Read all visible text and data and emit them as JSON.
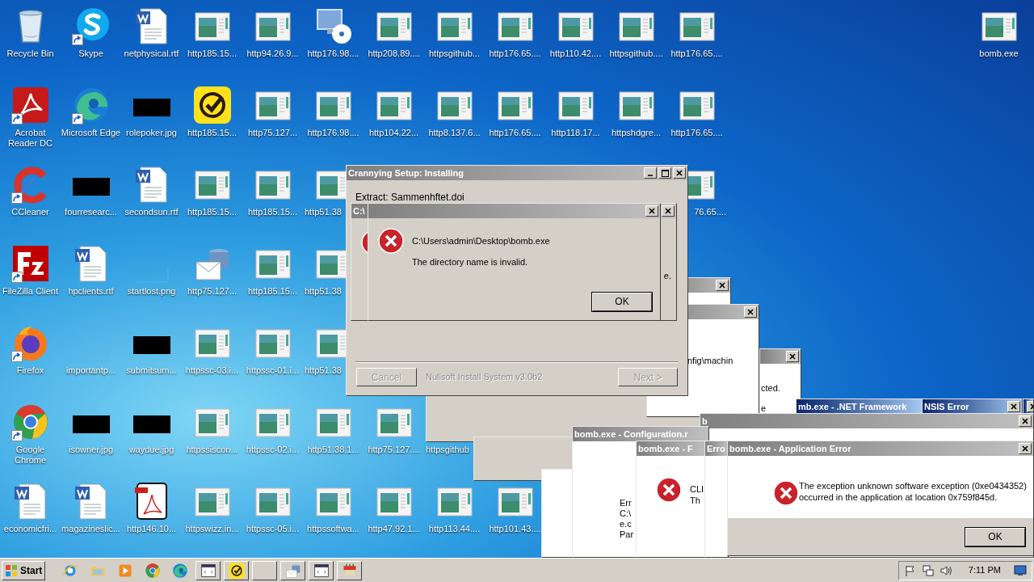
{
  "desktop": {
    "rows": [
      [
        {
          "label": "Recycle Bin",
          "kind": "recycle",
          "shortcut": false
        },
        {
          "label": "Skype",
          "kind": "skype",
          "shortcut": true
        },
        {
          "label": "netphysical.rtf",
          "kind": "word",
          "shortcut": false
        },
        {
          "label": "http185.15...",
          "kind": "web",
          "shortcut": false
        },
        {
          "label": "http94.26.9...",
          "kind": "web",
          "shortcut": false
        },
        {
          "label": "http176.98....",
          "kind": "setup",
          "shortcut": false
        },
        {
          "label": "http208.89....",
          "kind": "web",
          "shortcut": false
        },
        {
          "label": "httpsgithub...",
          "kind": "web",
          "shortcut": false
        },
        {
          "label": "http176.65....",
          "kind": "web",
          "shortcut": false
        },
        {
          "label": "http110.42....",
          "kind": "web",
          "shortcut": false
        },
        {
          "label": "httpsgithub....",
          "kind": "web",
          "shortcut": false
        },
        {
          "label": "http176.65....",
          "kind": "web",
          "shortcut": false
        }
      ],
      [
        {
          "label": "Acrobat\nReader DC",
          "kind": "acrobat",
          "shortcut": true
        },
        {
          "label": "Microsoft Edge",
          "kind": "edge",
          "shortcut": true
        },
        {
          "label": "rolepoker.jpg",
          "kind": "redacted",
          "shortcut": false
        },
        {
          "label": "http185.15...",
          "kind": "norton",
          "shortcut": false
        },
        {
          "label": "http75.127...",
          "kind": "web",
          "shortcut": false
        },
        {
          "label": "http176.98....",
          "kind": "web",
          "shortcut": false
        },
        {
          "label": "http104.22...",
          "kind": "web",
          "shortcut": false
        },
        {
          "label": "http8.137.6...",
          "kind": "web",
          "shortcut": false
        },
        {
          "label": "http176.65....",
          "kind": "web",
          "shortcut": false
        },
        {
          "label": "http118.17...",
          "kind": "web",
          "shortcut": false
        },
        {
          "label": "httpshdgre...",
          "kind": "web",
          "shortcut": false
        },
        {
          "label": "http176.65....",
          "kind": "web",
          "shortcut": false
        }
      ],
      [
        {
          "label": "CCleaner",
          "kind": "ccleaner",
          "shortcut": true
        },
        {
          "label": "fourresearc...",
          "kind": "redacted",
          "shortcut": false
        },
        {
          "label": "secondsun.rtf",
          "kind": "word",
          "shortcut": false
        },
        {
          "label": "http185.15...",
          "kind": "web",
          "shortcut": false
        },
        {
          "label": "http185.15...",
          "kind": "web",
          "shortcut": false
        },
        {
          "label": "http51.38",
          "kind": "web",
          "shortcut": false
        },
        {
          "kind": "gap"
        },
        {
          "kind": "gap"
        },
        {
          "kind": "gap"
        },
        {
          "kind": "gap"
        },
        {
          "kind": "gap"
        },
        {
          "label": "76.65....",
          "kind": "web",
          "shortcut": false
        }
      ],
      [
        {
          "label": "FileZilla Client",
          "kind": "filezilla",
          "shortcut": true
        },
        {
          "label": "hpclients.rtf",
          "kind": "word",
          "shortcut": false
        },
        {
          "label": "startlost.png",
          "kind": "blank",
          "shortcut": false
        },
        {
          "label": "http75.127...",
          "kind": "mail",
          "shortcut": false
        },
        {
          "label": "http185.15...",
          "kind": "web",
          "shortcut": false
        },
        {
          "label": "http51.38",
          "kind": "web",
          "shortcut": false
        }
      ],
      [
        {
          "label": "Firefox",
          "kind": "firefox",
          "shortcut": true
        },
        {
          "label": "importantp...",
          "kind": "blank",
          "shortcut": false
        },
        {
          "label": "submitsum...",
          "kind": "redacted",
          "shortcut": false
        },
        {
          "label": "httpssc-03.i...",
          "kind": "web",
          "shortcut": false
        },
        {
          "label": "httpssc-01.i...",
          "kind": "web",
          "shortcut": false
        },
        {
          "label": "http51.38",
          "kind": "web",
          "shortcut": false
        }
      ],
      [
        {
          "label": "Google\nChrome",
          "kind": "chrome",
          "shortcut": true
        },
        {
          "label": "isowner.jpg",
          "kind": "redacted",
          "shortcut": false
        },
        {
          "label": "waydue.jpg",
          "kind": "redacted",
          "shortcut": false
        },
        {
          "label": "httpssiscon...",
          "kind": "web",
          "shortcut": false
        },
        {
          "label": "httpssc-02.i...",
          "kind": "web",
          "shortcut": false
        },
        {
          "label": "http51.38.1...",
          "kind": "web",
          "shortcut": false
        },
        {
          "label": "http75.127....",
          "kind": "web",
          "shortcut": false
        },
        {
          "label": "httpsgithub",
          "kind": "covered"
        }
      ],
      [
        {
          "label": "economicfri...",
          "kind": "word",
          "shortcut": false
        },
        {
          "label": "magazineslic...",
          "kind": "word",
          "shortcut": false
        },
        {
          "label": "http146.10...",
          "kind": "pdf",
          "shortcut": false
        },
        {
          "label": "httpswizz.in...",
          "kind": "web",
          "shortcut": false
        },
        {
          "label": "httpssc-05.i...",
          "kind": "web",
          "shortcut": false
        },
        {
          "label": "httpssoftwa...",
          "kind": "web",
          "shortcut": false
        },
        {
          "label": "http47.92.1...",
          "kind": "web",
          "shortcut": false
        },
        {
          "label": "http113.44....",
          "kind": "web",
          "shortcut": false
        },
        {
          "label": "http101.43....",
          "kind": "web",
          "shortcut": false
        }
      ]
    ],
    "corner_icon": {
      "label": "bomb.exe",
      "kind": "web",
      "shortcut": false
    }
  },
  "windows": [
    {
      "kind": "blank"
    },
    {
      "kind": "blank"
    },
    {
      "kind": "blank"
    },
    {
      "kind": "fragment",
      "active": false
    },
    {
      "kind": "fragment",
      "active": false,
      "lines": [
        "nfig\\machin"
      ]
    },
    {
      "kind": "fragment",
      "active": false,
      "lines": [
        "cted.",
        "e"
      ]
    },
    {
      "kind": "fragment",
      "active": true,
      "title": "mb.exe - .NET Framework"
    },
    {
      "kind": "fragment",
      "active": true,
      "title": "NSIS Error"
    },
    {
      "kind": "fragment",
      "active": true
    },
    {
      "kind": "fragment",
      "active": false,
      "title": "b"
    },
    {
      "kind": "fragment",
      "active": false,
      "title": "bomb.exe - Configuration.r",
      "lines": [
        "Err",
        "C:\\",
        "e.c",
        "Par"
      ]
    },
    {
      "kind": "message",
      "active": false,
      "title": "bomb.exe - F",
      "lines": [
        "CLI",
        "Th"
      ]
    },
    {
      "kind": "fragment",
      "active": false,
      "title": "Erro"
    },
    {
      "kind": "message",
      "active": false,
      "title": "bomb.exe - Application Error",
      "lines": [
        "The exception unknown software exception (0xe0434352)",
        "occurred in the application at location 0x759f845d."
      ],
      "button": "OK"
    },
    {
      "kind": "installer",
      "active": false,
      "title": "Crannying Setup: Installing",
      "status": "Extract: Sammenhftet.doi",
      "cancel": {
        "label": "Cancel",
        "disabled": true
      },
      "brand": "Nullsoft Install System v3.0b2",
      "next": {
        "label": "Next >",
        "disabled": true
      }
    },
    {
      "kind": "message",
      "active": false,
      "title": "C:\\",
      "lines": [
        "e."
      ]
    },
    {
      "kind": "message",
      "active": false,
      "lines": [
        "C:\\Users\\admin\\Desktop\\bomb.exe",
        "The directory name is invalid."
      ],
      "button": "OK"
    }
  ],
  "taskbar": {
    "start": "Start",
    "items": [
      {
        "kind": "ie",
        "window": false
      },
      {
        "kind": "folder",
        "window": false
      },
      {
        "kind": "media",
        "window": false
      },
      {
        "kind": "chrome",
        "window": false
      },
      {
        "kind": "edge",
        "window": false
      },
      {
        "kind": "app",
        "window": true
      },
      {
        "kind": "norton",
        "window": true
      },
      {
        "kind": "none",
        "window": true
      },
      {
        "kind": "mail",
        "window": true
      },
      {
        "kind": "app",
        "window": true
      },
      {
        "kind": "paint",
        "window": true
      }
    ],
    "clock": "7:11 PM"
  }
}
